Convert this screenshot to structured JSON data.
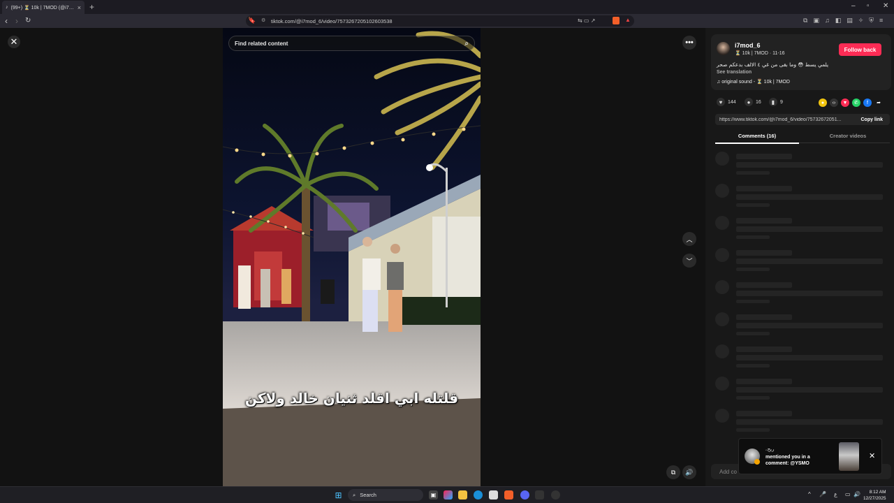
{
  "browser": {
    "tab_title": "(99+) ⏳ 10k | 7MOD (@i7mod",
    "tab_close": "×",
    "new_tab": "+",
    "url": "tiktok.com/@i7mod_6/video/7573267205102603538",
    "window_controls": [
      "–",
      "▫",
      "✕"
    ]
  },
  "video": {
    "search_placeholder": "Find related content",
    "caption": "قلتله ابي اقلد ثنيان خالد ولاكن"
  },
  "author": {
    "username": "i7mod_6",
    "subline": "⏳ 10k | 7MOD · 11-16",
    "follow_label": "Follow back",
    "description": "يلمي يسط 😳 وما بقى من غي ٤ الالف بدعكم صحر",
    "see_translation": "See translation",
    "sound": "original sound - ⏳ 10k | 7MOD"
  },
  "stats": {
    "likes": "144",
    "comments": "16",
    "saves": "9"
  },
  "link": {
    "url": "https://www.tiktok.com/@i7mod_6/video/75732672051...",
    "copy_label": "Copy link"
  },
  "tabs": {
    "comments": "Comments (16)",
    "creator_videos": "Creator videos"
  },
  "add_comment_placeholder": "Add co",
  "notification": {
    "name": "ريحۦ",
    "message": "mentioned you in a comment: @YSMO"
  },
  "taskbar": {
    "search_label": "Search",
    "time": "8:12 AM",
    "date": "12/27/2025",
    "lang": "ع"
  },
  "colors": {
    "follow": "#fe2c55",
    "background": "#121212"
  }
}
